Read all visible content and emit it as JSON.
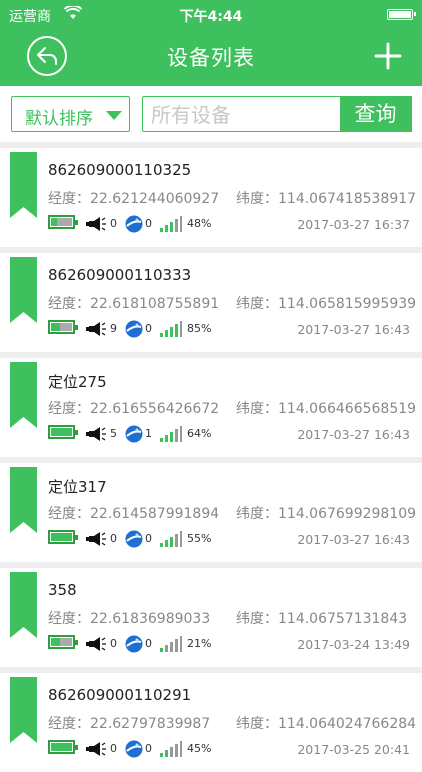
{
  "status_bar": {
    "carrier": "运营商",
    "time": "下午4:44"
  },
  "nav": {
    "title": "设备列表"
  },
  "filter": {
    "sort_label": "默认排序",
    "search_placeholder": "所有设备",
    "search_button": "查询"
  },
  "colors": {
    "accent": "#3fc05f",
    "battery_border": "#2e9f3e",
    "battery_empty": "#aaaaaa",
    "satellite_blue": "#1e6fd0"
  },
  "icons": {
    "back": "back-arrow-icon",
    "add": "plus-icon",
    "sort": "caret-down-icon",
    "bookmark": "bookmark-icon",
    "battery": "battery-icon",
    "alarm": "horn-icon",
    "gps": "satellite-icon",
    "signal": "signal-bars-icon"
  },
  "devices": [
    {
      "name": "862609000110325",
      "lng_label": "经度：",
      "lng": "22.621244060927",
      "lat_label": "纬度：",
      "lat": "114.067418538917",
      "battery_fraction": 0.3,
      "alarm_count": "0",
      "gps_count": "0",
      "signal_bars": 3,
      "signal": "48%",
      "date": "2017-03-27 16:37"
    },
    {
      "name": "862609000110333",
      "lng_label": "经度：",
      "lng": "22.618108755891",
      "lat_label": "纬度：",
      "lat": "114.065815995939",
      "battery_fraction": 0.45,
      "alarm_count": "9",
      "gps_count": "0",
      "signal_bars": 4,
      "signal": "85%",
      "date": "2017-03-27 16:43"
    },
    {
      "name": "定位275",
      "lng_label": "经度：",
      "lng": "22.616556426672",
      "lat_label": "纬度：",
      "lat": "114.066466568519",
      "battery_fraction": 1.0,
      "alarm_count": "5",
      "gps_count": "1",
      "signal_bars": 3,
      "signal": "64%",
      "date": "2017-03-27 16:43"
    },
    {
      "name": "定位317",
      "lng_label": "经度：",
      "lng": "22.614587991894",
      "lat_label": "纬度：",
      "lat": "114.067699298109",
      "battery_fraction": 1.0,
      "alarm_count": "0",
      "gps_count": "0",
      "signal_bars": 3,
      "signal": "55%",
      "date": "2017-03-27 16:43"
    },
    {
      "name": "358",
      "lng_label": "经度：",
      "lng": "22.61836989033",
      "lat_label": "纬度：",
      "lat": "114.06757131843",
      "battery_fraction": 0.45,
      "alarm_count": "0",
      "gps_count": "0",
      "signal_bars": 1,
      "signal": "21%",
      "date": "2017-03-24 13:49"
    },
    {
      "name": "862609000110291",
      "lng_label": "经度：",
      "lng": "22.62797839987",
      "lat_label": "纬度：",
      "lat": "114.064024766284",
      "battery_fraction": 1.0,
      "alarm_count": "0",
      "gps_count": "0",
      "signal_bars": 2,
      "signal": "45%",
      "date": "2017-03-25 20:41"
    }
  ]
}
